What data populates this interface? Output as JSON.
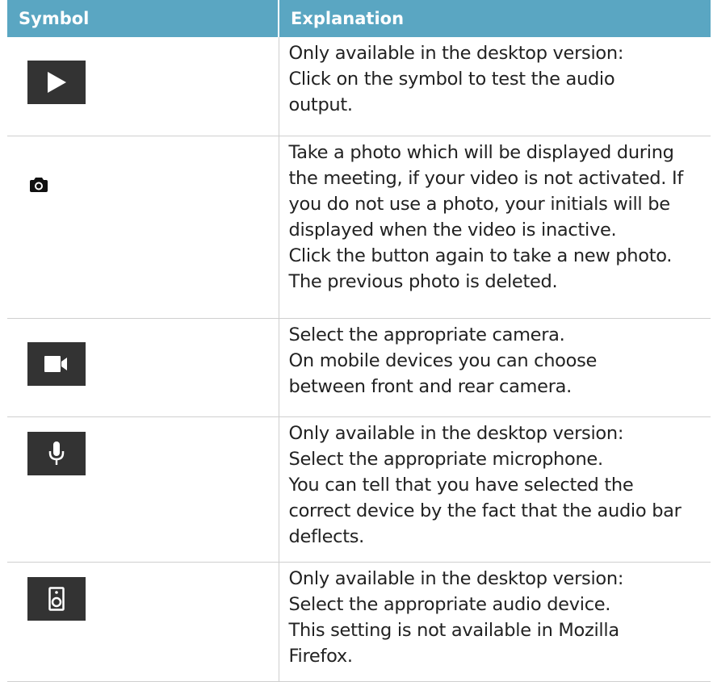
{
  "table": {
    "headers": [
      "Symbol",
      "Explanation"
    ],
    "rows": [
      {
        "icon": "play-icon",
        "lines": [
          "Only available in the desktop version:",
          "Click on the symbol to test the audio",
          "output."
        ]
      },
      {
        "icon": "camera-icon",
        "lines": [
          "Take a photo which will be displayed during",
          "the meeting, if your video is not activated. If",
          "you do not use a photo, your initials will be",
          "displayed when the video is inactive.",
          "Click the button again to take a new photo.",
          "The previous photo is deleted."
        ]
      },
      {
        "icon": "video-camera-icon",
        "lines": [
          "Select the appropriate camera.",
          "On mobile devices you can choose",
          "between front and rear camera."
        ]
      },
      {
        "icon": "microphone-icon",
        "lines": [
          "Only available in the desktop version:",
          "Select the appropriate microphone.",
          "You can tell that you have selected the",
          "correct device by the fact that the audio bar",
          "deflects."
        ]
      },
      {
        "icon": "speaker-icon",
        "lines": [
          "Only available in the desktop version:",
          "Select the appropriate audio device.",
          "This setting is not available in Mozilla",
          "Firefox."
        ]
      }
    ]
  }
}
